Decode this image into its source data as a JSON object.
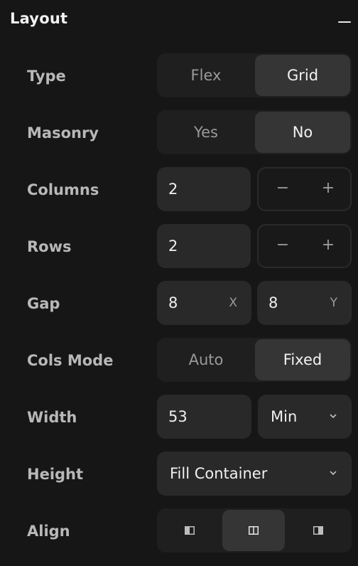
{
  "panel": {
    "title": "Layout",
    "collapse_icon": "minus-icon"
  },
  "type": {
    "label": "Type",
    "options": [
      "Flex",
      "Grid"
    ],
    "selected": "Grid"
  },
  "masonry": {
    "label": "Masonry",
    "options": [
      "Yes",
      "No"
    ],
    "selected": "No"
  },
  "columns": {
    "label": "Columns",
    "value": "2",
    "decrement": "−",
    "increment": "+"
  },
  "rows": {
    "label": "Rows",
    "value": "2",
    "decrement": "−",
    "increment": "+"
  },
  "gap": {
    "label": "Gap",
    "x_value": "8",
    "x_suffix": "X",
    "y_value": "8",
    "y_suffix": "Y"
  },
  "cols_mode": {
    "label": "Cols Mode",
    "options": [
      "Auto",
      "Fixed"
    ],
    "selected": "Fixed"
  },
  "width": {
    "label": "Width",
    "value": "53",
    "mode": "Min"
  },
  "height": {
    "label": "Height",
    "value": "Fill Container"
  },
  "align": {
    "label": "Align",
    "options": [
      "align-left-icon",
      "align-center-icon",
      "align-right-icon"
    ],
    "selected": "align-center-icon"
  },
  "colors": {
    "background": "#161616",
    "control": "#292929",
    "selected": "#353535",
    "label": "#b8b8b8"
  }
}
